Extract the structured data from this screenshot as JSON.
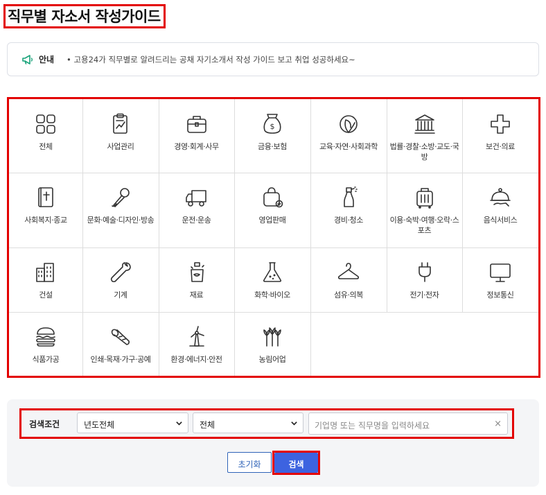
{
  "page_title": "직무별 자소서 작성가이드",
  "notice": {
    "icon": "megaphone-icon",
    "label": "안내",
    "text": "• 고용24가 직무별로 알려드리는 공채 자기소개서 작성 가이드 보고 취업 성공하세요~"
  },
  "categories": [
    {
      "label": "전체",
      "icon": "grid-all-icon"
    },
    {
      "label": "사업관리",
      "icon": "clipboard-chart-icon"
    },
    {
      "label": "경영·회계·사무",
      "icon": "briefcase-icon"
    },
    {
      "label": "금융·보험",
      "icon": "money-bag-icon"
    },
    {
      "label": "교육·자연·사회과학",
      "icon": "globe-leaf-icon"
    },
    {
      "label": "법률·경찰·소방·교도·국방",
      "icon": "courthouse-icon"
    },
    {
      "label": "보건·의료",
      "icon": "medical-cross-icon"
    },
    {
      "label": "사회복지·종교",
      "icon": "bible-icon"
    },
    {
      "label": "문화·예술·디자인·방송",
      "icon": "microphone-icon"
    },
    {
      "label": "운전·운송",
      "icon": "truck-icon"
    },
    {
      "label": "영업판매",
      "icon": "shopping-bag-icon"
    },
    {
      "label": "경비·청소",
      "icon": "spray-bottle-icon"
    },
    {
      "label": "이용·숙박·여행·오락·스포츠",
      "icon": "suitcase-icon"
    },
    {
      "label": "음식서비스",
      "icon": "cloche-icon"
    },
    {
      "label": "건설",
      "icon": "buildings-icon"
    },
    {
      "label": "기계",
      "icon": "wrench-icon"
    },
    {
      "label": "재료",
      "icon": "materials-icon"
    },
    {
      "label": "화학·바이오",
      "icon": "flask-icon"
    },
    {
      "label": "섬유·의복",
      "icon": "hanger-icon"
    },
    {
      "label": "전기·전자",
      "icon": "plug-icon"
    },
    {
      "label": "정보통신",
      "icon": "monitor-icon"
    },
    {
      "label": "식품가공",
      "icon": "burger-icon"
    },
    {
      "label": "인쇄·목재·가구·공예",
      "icon": "wood-log-icon"
    },
    {
      "label": "환경·에너지·안전",
      "icon": "wind-turbine-icon"
    },
    {
      "label": "농림어업",
      "icon": "sprouts-icon"
    }
  ],
  "search": {
    "label": "검색조건",
    "year_select": "년도전체",
    "category_select": "전체",
    "keyword_placeholder": "기업명 또는 직무명을 입력하세요",
    "clear_glyph": "×",
    "reset_label": "초기화",
    "search_label": "검색"
  },
  "colors": {
    "highlight": "#e30000",
    "primary": "#3d63e0",
    "accent_green": "#1aa37a"
  }
}
